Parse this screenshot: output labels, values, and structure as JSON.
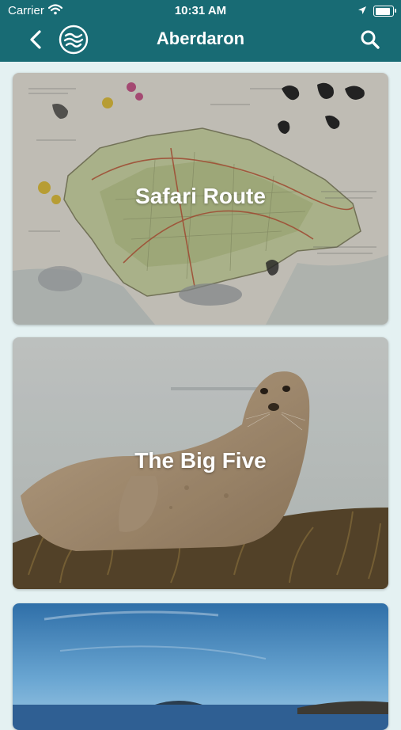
{
  "status_bar": {
    "carrier": "Carrier",
    "time": "10:31 AM"
  },
  "nav": {
    "title": "Aberdaron"
  },
  "cards": [
    {
      "label": "Safari Route"
    },
    {
      "label": "The Big Five"
    },
    {
      "label": ""
    }
  ],
  "colors": {
    "nav_background": "#186b74",
    "page_background": "#e4f1f2"
  },
  "icons": [
    "wifi-icon",
    "location-arrow-icon",
    "battery-icon",
    "back-chevron-icon",
    "app-logo-icon",
    "search-icon"
  ]
}
